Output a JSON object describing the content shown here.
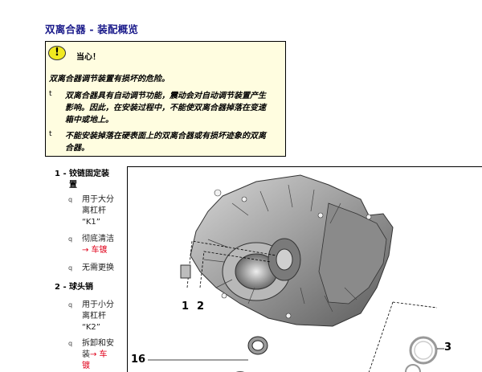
{
  "title": "双离合器 - 装配概览",
  "caution": {
    "icon": "warning-exclamation-icon",
    "heading": "当心！",
    "lead": "双离合器调节装置有损坏的危险。",
    "bullets": [
      {
        "marker": "t",
        "lines": [
          "双离合器具有自动调节功能，震动会对自动调节装置产生",
          "影响。因此，在安装过程中，不能使双离合器掉落在变速",
          "箱中或地上。"
        ]
      },
      {
        "marker": "t",
        "lines": [
          "不能安装掉落在硬表面上的双离合器或有损坏迹象的双离",
          "合器。"
        ]
      }
    ]
  },
  "parts": [
    {
      "number": "1 -",
      "name_lines": [
        "铰链固定装",
        "置"
      ],
      "notes": [
        {
          "marker": "q",
          "lines": [
            "用于大分",
            "离杠杆",
            "“K1”"
          ]
        },
        {
          "marker": "q",
          "lines": [
            "彻底清洁"
          ],
          "link": "→ 车镀"
        },
        {
          "marker": "q",
          "lines": [
            "无需更换"
          ]
        }
      ]
    },
    {
      "number": "2 -",
      "name_lines": [
        "球头销"
      ],
      "notes": [
        {
          "marker": "q",
          "lines": [
            "用于小分",
            "离杠杆",
            "“K2”"
          ]
        },
        {
          "marker": "q",
          "lines": [
            "拆卸和安",
            "装"
          ],
          "link_inline": "→ 车",
          "link": "镀"
        }
      ]
    }
  ],
  "figure": {
    "callouts": [
      "1",
      "2",
      "16",
      "3"
    ]
  }
}
